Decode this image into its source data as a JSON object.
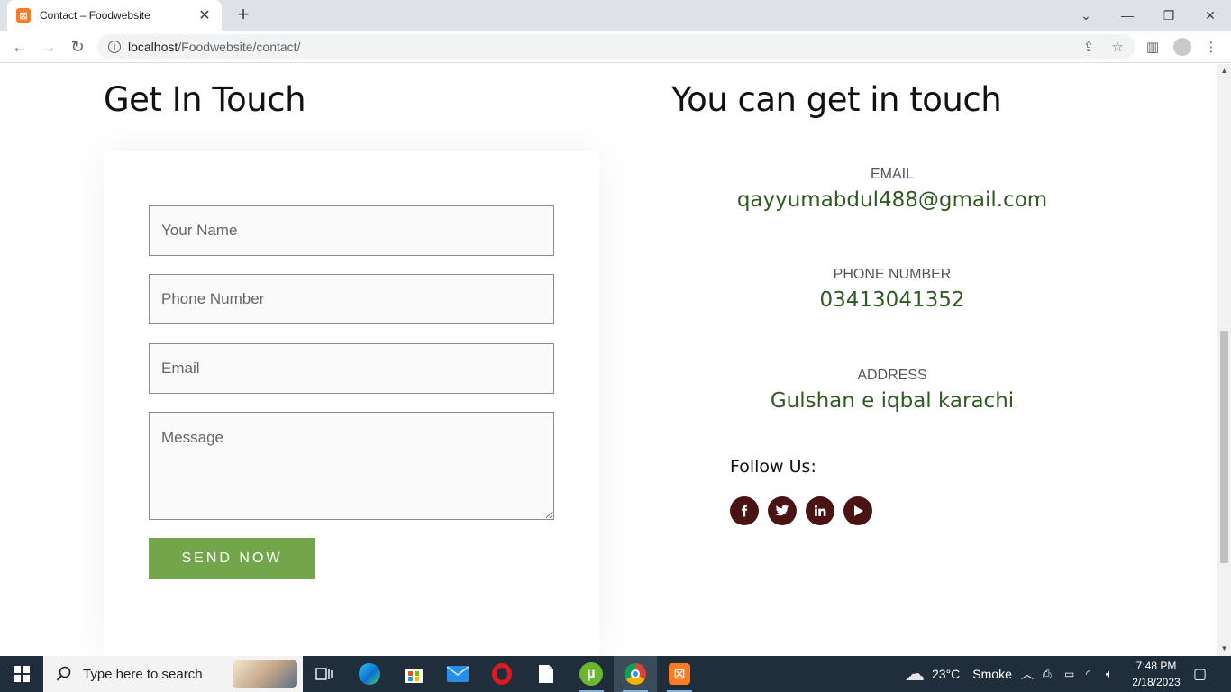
{
  "browser": {
    "tab_title": "Contact – Foodwebsite",
    "url_host": "localhost",
    "url_path": "/Foodwebsite/contact/"
  },
  "page": {
    "left_heading": "Get In Touch",
    "right_heading": "You can get in touch",
    "form": {
      "name_placeholder": "Your Name",
      "phone_placeholder": "Phone Number",
      "email_placeholder": "Email",
      "message_placeholder": "Message",
      "send_label": "SEND NOW"
    },
    "contact": {
      "email_label": "EMAIL",
      "email_value": "qayyumabdul488@gmail.com",
      "phone_label": "PHONE NUMBER",
      "phone_value": "03413041352",
      "address_label": "ADDRESS",
      "address_value": "Gulshan e iqbal karachi"
    },
    "follow_label": "Follow Us:",
    "social": [
      "facebook-icon",
      "twitter-icon",
      "linkedin-icon",
      "youtube-icon"
    ],
    "accent_color": "#73a64a",
    "social_color": "#4a1414",
    "value_color": "#2f5a22"
  },
  "taskbar": {
    "search_placeholder": "Type here to search",
    "weather_temp": "23°C",
    "weather_text": "Smoke",
    "time": "7:48 PM",
    "date": "2/18/2023"
  }
}
